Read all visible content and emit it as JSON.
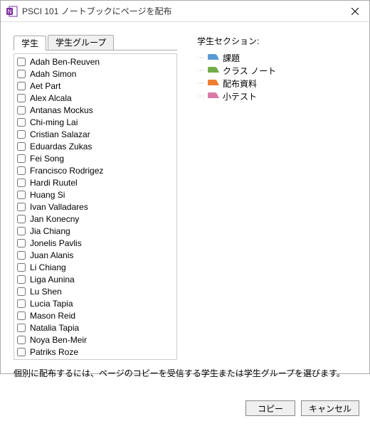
{
  "window": {
    "title": "PSCI 101 ノートブックにページを配布"
  },
  "tabs": {
    "students": "学生",
    "groups": "学生グループ"
  },
  "sections_header": "学生セクション:",
  "students": [
    "Adah Ben-Reuven",
    "Adah Simon",
    "Aet Part",
    "Alex Alcala",
    "Antanas Mockus",
    "Chi-ming Lai",
    "Cristian Salazar",
    "Eduardas Zukas",
    "Fei Song",
    "Francisco Rodrigez",
    "Hardi Ruutel",
    "Huang Si",
    "Ivan Valladares",
    "Jan Konecny",
    "Jia Chiang",
    "Jonelis Pavlis",
    "Juan Alanis",
    "Li Chiang",
    "Liga Aunina",
    "Lu Shen",
    "Lucia Tapia",
    "Mason Reid",
    "Natalia Tapia",
    "Noya Ben-Meir",
    "Patriks Roze"
  ],
  "sections": [
    {
      "label": "課題",
      "color": "#5b9bd5"
    },
    {
      "label": "クラス ノート",
      "color": "#70ad47"
    },
    {
      "label": "配布資料",
      "color": "#ed7d31"
    },
    {
      "label": "小テスト",
      "color": "#d87ba9"
    }
  ],
  "footer_text": "個別に配布するには、ページのコピーを受信する学生または学生グループを選びます。",
  "buttons": {
    "copy": "コピー",
    "cancel": "キャンセル"
  }
}
